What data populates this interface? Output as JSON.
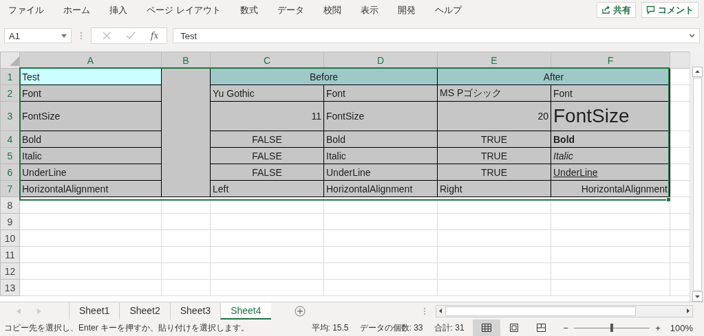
{
  "menu": {
    "items": [
      "ファイル",
      "ホーム",
      "挿入",
      "ページ レイアウト",
      "数式",
      "データ",
      "校閲",
      "表示",
      "開発",
      "ヘルプ"
    ],
    "share_button": "共有",
    "comment_button": "コメント"
  },
  "formula_bar": {
    "name_box": "A1",
    "function_label": "fx",
    "formula": "Test"
  },
  "sheet": {
    "columns": [
      {
        "label": "A",
        "selected": true
      },
      {
        "label": "B",
        "selected": true
      },
      {
        "label": "C",
        "selected": true
      },
      {
        "label": "D",
        "selected": true
      },
      {
        "label": "E",
        "selected": true
      },
      {
        "label": "F",
        "selected": true
      }
    ],
    "rows": [
      {
        "number": "1",
        "selected": true,
        "cells": [
          {
            "kind": "text",
            "text": "Test",
            "color": "#ccffff"
          },
          {
            "kind": "merged_column",
            "color": "#c6c6c6"
          },
          {
            "kind": "group_header",
            "text": "Before",
            "color": "#9fc9c9"
          },
          {
            "kind": "group_header",
            "text": "After",
            "color": "#9fc9c9"
          }
        ]
      },
      {
        "number": "2",
        "selected": true,
        "cells": [
          {
            "kind": "text",
            "text": "Font",
            "color": "#c6c6c6"
          },
          {
            "kind": "text",
            "text": "Yu Gothic",
            "color": "#c6c6c6"
          },
          {
            "kind": "text",
            "text": "Font",
            "color": "#c6c6c6"
          },
          {
            "kind": "text",
            "text": "MS Pゴシック",
            "color": "#c6c6c6"
          },
          {
            "kind": "text",
            "text": "Font",
            "color": "#c6c6c6"
          }
        ]
      },
      {
        "number": "3",
        "selected": true,
        "cells": [
          {
            "kind": "text",
            "text": "FontSize",
            "color": "#c6c6c6"
          },
          {
            "kind": "number",
            "text": "11",
            "color": "#c6c6c6"
          },
          {
            "kind": "text",
            "text": "FontSize",
            "color": "#c6c6c6"
          },
          {
            "kind": "number",
            "text": "20",
            "color": "#c6c6c6"
          },
          {
            "kind": "large",
            "text": "FontSize",
            "color": "#c6c6c6"
          }
        ]
      },
      {
        "number": "4",
        "selected": true,
        "cells": [
          {
            "kind": "text",
            "text": "Bold",
            "color": "#c6c6c6"
          },
          {
            "kind": "boolean",
            "text": "FALSE",
            "color": "#c6c6c6"
          },
          {
            "kind": "text",
            "text": "Bold",
            "color": "#c6c6c6"
          },
          {
            "kind": "boolean",
            "text": "TRUE",
            "color": "#c6c6c6"
          },
          {
            "kind": "bold",
            "text": "Bold",
            "color": "#c6c6c6"
          }
        ]
      },
      {
        "number": "5",
        "selected": true,
        "cells": [
          {
            "kind": "text",
            "text": "Italic",
            "color": "#c6c6c6"
          },
          {
            "kind": "boolean",
            "text": "FALSE",
            "color": "#c6c6c6"
          },
          {
            "kind": "text",
            "text": "Italic",
            "color": "#c6c6c6"
          },
          {
            "kind": "boolean",
            "text": "TRUE",
            "color": "#c6c6c6"
          },
          {
            "kind": "italic",
            "text": "Italic",
            "color": "#c6c6c6"
          }
        ]
      },
      {
        "number": "6",
        "selected": true,
        "cells": [
          {
            "kind": "text",
            "text": "UnderLine",
            "color": "#c6c6c6"
          },
          {
            "kind": "boolean",
            "text": "FALSE",
            "color": "#c6c6c6"
          },
          {
            "kind": "text",
            "text": "UnderLine",
            "color": "#c6c6c6"
          },
          {
            "kind": "boolean",
            "text": "TRUE",
            "color": "#c6c6c6"
          },
          {
            "kind": "underline",
            "text": "UnderLine",
            "color": "#c6c6c6"
          }
        ]
      },
      {
        "number": "7",
        "selected": true,
        "cells": [
          {
            "kind": "text",
            "text": "HorizontalAlignment",
            "color": "#c6c6c6"
          },
          {
            "kind": "text",
            "text": "Left",
            "color": "#c6c6c6"
          },
          {
            "kind": "text",
            "text": "HorizontalAlignment",
            "color": "#c6c6c6"
          },
          {
            "kind": "text",
            "text": "Right",
            "color": "#c6c6c6"
          },
          {
            "kind": "right",
            "text": "HorizontalAlignment",
            "color": "#c6c6c6"
          }
        ]
      },
      {
        "number": "8",
        "selected": false
      },
      {
        "number": "9",
        "selected": false
      },
      {
        "number": "10",
        "selected": false
      },
      {
        "number": "11",
        "selected": false
      },
      {
        "number": "12",
        "selected": false
      },
      {
        "number": "13",
        "selected": false
      }
    ]
  },
  "sheet_tabs": [
    {
      "label": "Sheet1",
      "selected": false
    },
    {
      "label": "Sheet2",
      "selected": false
    },
    {
      "label": "Sheet3",
      "selected": false
    },
    {
      "label": "Sheet4",
      "selected": true
    }
  ],
  "status_bar": {
    "message": "コピー先を選択し、Enter キーを押すか、貼り付けを選択します。",
    "average": "平均: 15.5",
    "count": "データの個数: 33",
    "sum": "合計: 31",
    "views": [
      {
        "kind": "normal",
        "selected": true
      },
      {
        "kind": "page_layout",
        "selected": false
      },
      {
        "kind": "page_break",
        "selected": false
      }
    ],
    "zoom_out": "−",
    "zoom_in": "+",
    "zoom": {
      "level": 0.5
    },
    "zoom_percent": "100%"
  }
}
